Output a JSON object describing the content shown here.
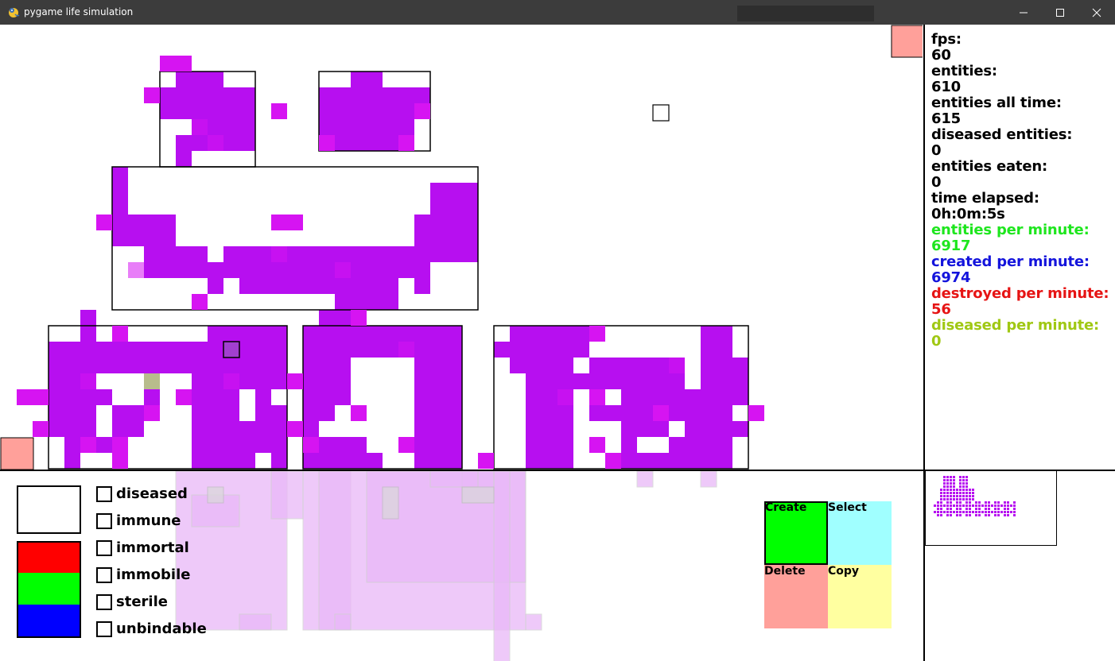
{
  "window": {
    "title": "pygame life simulation",
    "minimize_icon": "minimize-icon",
    "maximize_icon": "maximize-icon",
    "close_icon": "close-icon",
    "app_icon": "pygame-snake-icon"
  },
  "stats": [
    {
      "label": "fps:",
      "value": "60",
      "color": "#000000"
    },
    {
      "label": "entities:",
      "value": "610",
      "color": "#000000"
    },
    {
      "label": "entities all time:",
      "value": "615",
      "color": "#000000"
    },
    {
      "label": "diseased entities:",
      "value": "0",
      "color": "#000000"
    },
    {
      "label": "entities eaten:",
      "value": "0",
      "color": "#000000"
    },
    {
      "label": "time elapsed:",
      "value": "0h:0m:5s",
      "color": "#000000"
    },
    {
      "label": "entities per minute:",
      "value": "6917",
      "color": "#1ee61e"
    },
    {
      "label": "created per minute:",
      "value": "6974",
      "color": "#1414dc"
    },
    {
      "label": "destroyed per minute:",
      "value": "56",
      "color": "#e61414"
    },
    {
      "label": "diseased per minute:",
      "value": "0",
      "color": "#a0c814"
    }
  ],
  "options": {
    "checkboxes": [
      {
        "label": "diseased",
        "checked": false
      },
      {
        "label": "immune",
        "checked": false
      },
      {
        "label": "immortal",
        "checked": false
      },
      {
        "label": "immobile",
        "checked": false
      },
      {
        "label": "sterile",
        "checked": false
      },
      {
        "label": "unbindable",
        "checked": false
      }
    ],
    "color_swatches": [
      {
        "name": "current-color",
        "color": "#ffffff"
      },
      {
        "name": "red-channel",
        "color": "#ff0000"
      },
      {
        "name": "green-channel",
        "color": "#00ff00"
      },
      {
        "name": "blue-channel",
        "color": "#0000ff"
      }
    ]
  },
  "tools": [
    {
      "label": "Create",
      "color": "#00ff00",
      "selected": true
    },
    {
      "label": "Select",
      "color": "#a0ffff",
      "selected": false
    },
    {
      "label": "Delete",
      "color": "#ffa09a",
      "selected": false
    },
    {
      "label": "Copy",
      "color": "#ffffa0",
      "selected": false
    }
  ],
  "colors": {
    "entity_purple": "#b70ff0",
    "entity_magenta": "#d614f2",
    "corner_marker": "#ffa09a",
    "diseased_cell": "#b8bc8c"
  }
}
